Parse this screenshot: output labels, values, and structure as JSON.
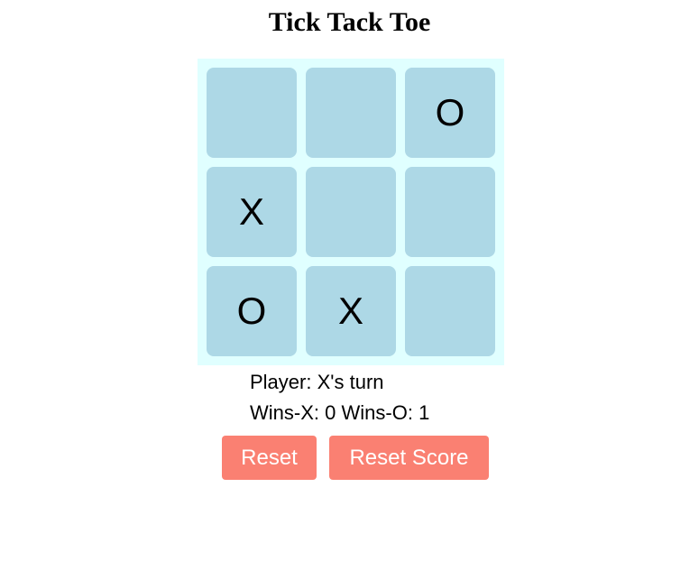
{
  "title": "Tick Tack Toe",
  "board": {
    "cells": [
      "",
      "",
      "O",
      "X",
      "",
      "",
      "O",
      "X",
      ""
    ]
  },
  "status": {
    "player_label": "Player:",
    "turn_text": "X's turn",
    "wins_x_label": "Wins-X:",
    "wins_x": "0",
    "wins_o_label": "Wins-O:",
    "wins_o": "1"
  },
  "buttons": {
    "reset_label": "Reset",
    "reset_score_label": "Reset Score"
  },
  "colors": {
    "board_background": "#e0ffff",
    "cell_background": "#add8e6",
    "button_background": "#fa8072",
    "button_text": "#ffffff"
  }
}
